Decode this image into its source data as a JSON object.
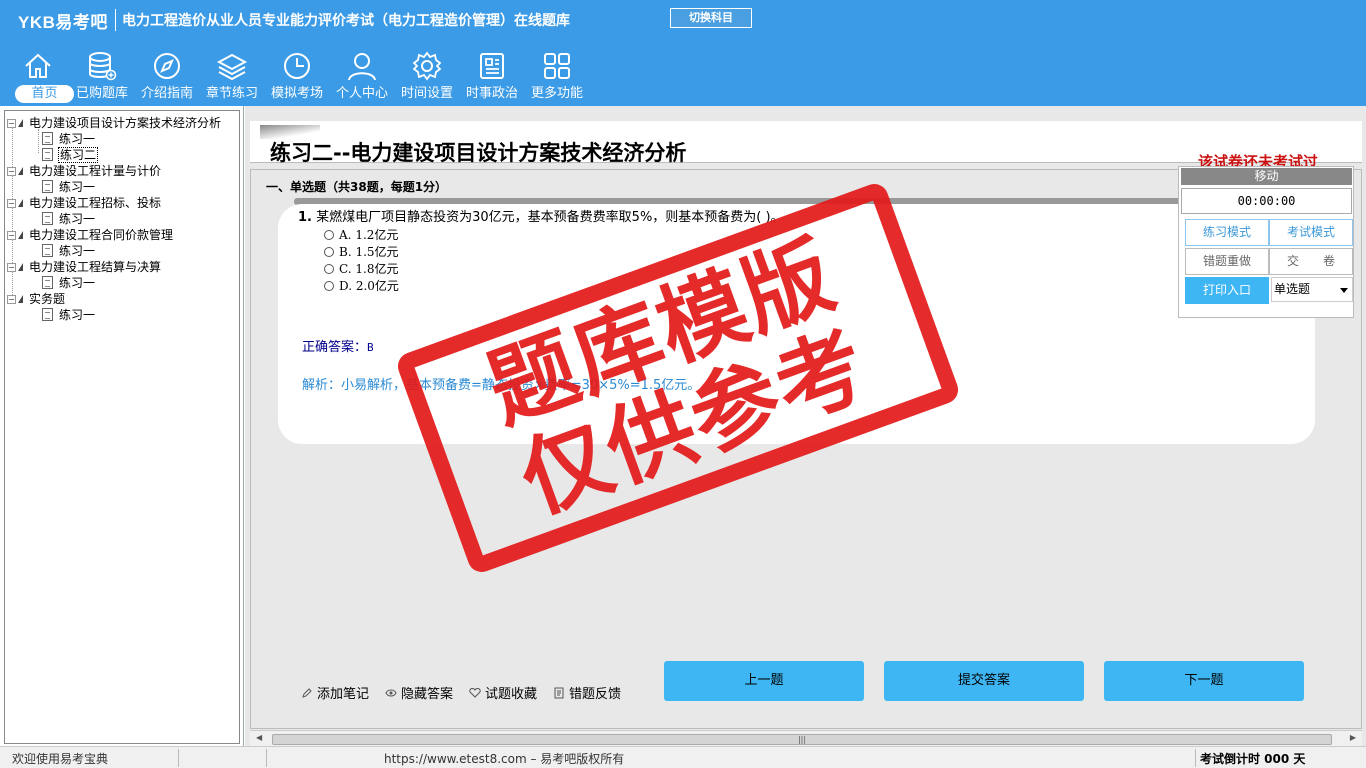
{
  "header": {
    "brand": "YKB易考吧",
    "title": "电力工程造价从业人员专业能力评价考试（电力工程造价管理）在线题库",
    "switch_label": "切换科目"
  },
  "nav": [
    {
      "label": "首页",
      "icon": "home-icon"
    },
    {
      "label": "已购题库",
      "icon": "database-icon"
    },
    {
      "label": "介绍指南",
      "icon": "compass-icon"
    },
    {
      "label": "章节练习",
      "icon": "layers-icon"
    },
    {
      "label": "模拟考场",
      "icon": "clock-icon"
    },
    {
      "label": "个人中心",
      "icon": "user-icon"
    },
    {
      "label": "时间设置",
      "icon": "gear-icon"
    },
    {
      "label": "时事政治",
      "icon": "news-icon"
    },
    {
      "label": "更多功能",
      "icon": "grid-icon"
    }
  ],
  "tree": [
    {
      "label": "电力建设项目设计方案技术经济分析",
      "children": [
        "练习一",
        "练习二"
      ]
    },
    {
      "label": "电力建设工程计量与计价",
      "children": [
        "练习一"
      ]
    },
    {
      "label": "电力建设工程招标、投标",
      "children": [
        "练习一"
      ]
    },
    {
      "label": "电力建设工程合同价款管理",
      "children": [
        "练习一"
      ]
    },
    {
      "label": "电力建设工程结算与决算",
      "children": [
        "练习一"
      ]
    },
    {
      "label": "实务题",
      "children": [
        "练习一"
      ]
    }
  ],
  "paper": {
    "title": "练习二--电力建设项目设计方案技术经济分析",
    "status": "该试卷还未考试过",
    "section": "一、单选题（共38题，每题1分）"
  },
  "question": {
    "number": "1.",
    "text": "某燃煤电厂项目静态投资为30亿元，基本预备费费率取5%，则基本预备费为(  )。",
    "options": [
      {
        "key": "A.",
        "text": "1.2亿元"
      },
      {
        "key": "B.",
        "text": "1.5亿元"
      },
      {
        "key": "C.",
        "text": "1.8亿元"
      },
      {
        "key": "D.",
        "text": "2.0亿元"
      }
    ],
    "answer_label": "正确答案：",
    "answer_value": "B",
    "explain": "解析：小易解析，基本预备费=静态投资×费率=30×5%=1.5亿元。"
  },
  "tools": [
    "添加笔记",
    "隐藏答案",
    "试题收藏",
    "错题反馈"
  ],
  "buttons": {
    "prev": "上一题",
    "submit": "提交答案",
    "next": "下一题"
  },
  "panel": {
    "move": "移动",
    "timer": "00:00:00",
    "practice_mode": "练习模式",
    "exam_mode": "考试模式",
    "redo_wrong": "错题重做",
    "hand_in": "交　　卷",
    "print": "打印入口",
    "type_select": "单选题"
  },
  "stamp": {
    "line1": "题库模版",
    "line2": "仅供参考",
    "color": "#e31919"
  },
  "statusbar": {
    "welcome": "欢迎使用易考宝典",
    "copyright": "https://www.etest8.com – 易考吧版权所有",
    "countdown": "考试倒计时 000 天"
  },
  "colors": {
    "accent": "#3c9be6",
    "button": "#3fb6f4",
    "warning": "#cc1111"
  }
}
